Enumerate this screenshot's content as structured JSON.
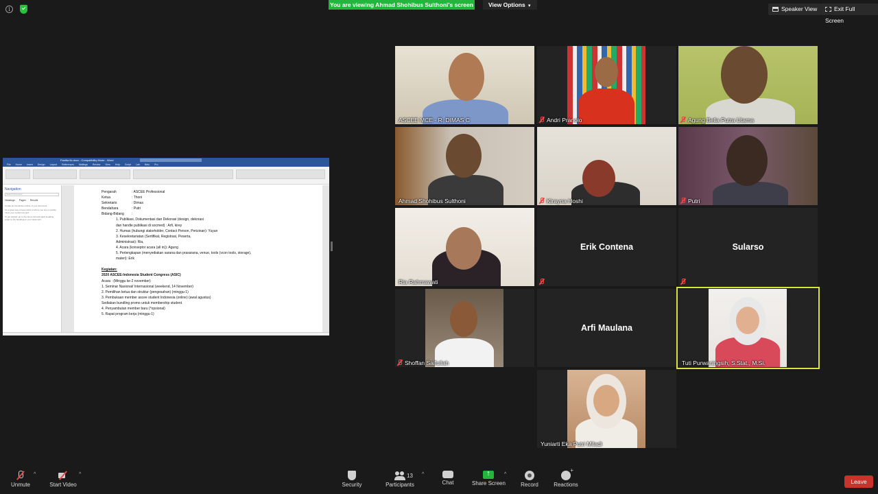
{
  "topbar": {
    "viewing_banner": "You are viewing Ahmad Shohibus Sulthoni's screen",
    "view_options": "View Options",
    "speaker_view": "Speaker View",
    "exit_full_screen": "Exit Full Screen"
  },
  "document": {
    "window_title": "Panitia fix.docx - Compatibility Mode - Word",
    "ribbon_tabs": [
      "File",
      "Home",
      "Insert",
      "Design",
      "Layout",
      "References",
      "Mailings",
      "Review",
      "View",
      "Help",
      "Script Lab",
      "Nitro Pro"
    ],
    "nav_pane": {
      "title": "Navigation",
      "search_placeholder": "Search document",
      "tabs": [
        "Headings",
        "Pages",
        "Results"
      ],
      "note1": "Create an interactive outline of your document.",
      "note2": "It's a great way to keep track of where you are or quickly move your content around.",
      "note3": "To get started, go to the Home tab and apply Heading styles to the headings in your document."
    },
    "lines": [
      {
        "key": "Pengarah",
        "val": ": ASCEE Professional"
      },
      {
        "key": "Ketua",
        "val": ": Thoni"
      },
      {
        "key": "Sekretaris",
        "val": ": Dimas"
      },
      {
        "key": "Bendahara",
        "val": ": Putri"
      },
      {
        "key": "Bidang-Bidang",
        "val": ":"
      }
    ],
    "list_items": [
      "1.    Publikasi, Dokumentasi dan Dekorasi (design, dekorasi",
      "       dan handle publikasi di socmed) : Arfi, kirey",
      "2.    Humas (hubungi stakeholder, Contact Person, Perizinan): Yuyun",
      "3.    Kesekretariatan (Sertifikat, Registrasi, Peserta,",
      "       Administrasi): Ria,",
      "4.    Acara (konseptor acara (all in)): Agung",
      "5.    Perlengkapan (menyediakan sarana dan prasarana, venue, tools (vcon  tools, storage),",
      "       materi): Erik"
    ],
    "kegiatan_heading": "Kegiatan:",
    "event_title": "2020 ASCEE-Indonesia Student Congress (ASIC)",
    "event_lines": [
      "Acara : (Minggu ke-2 november)",
      "1. Seminar Nasional/ Internasional (weekend, 14 November)",
      "2. Pemilihan ketua dan struktur (pengesahan) (minggu-1)",
      "3. Pembukaan member ascee student Indonesia (online) (awal agustus)",
      "Sediakan bundling promo untuk membership student",
      "4. Penyambutan member baru (*opsional)",
      "5. Rapat program kerja (minggu-1)"
    ]
  },
  "participants": [
    {
      "name": "ASCEE MCE - R. DIMAS C",
      "muted": false
    },
    {
      "name": "Andri Pranolo",
      "muted": true
    },
    {
      "name": "Agung Bella Putra Utama",
      "muted": true
    },
    {
      "name": "Ahmad Shohibus Sulthoni",
      "muted": false
    },
    {
      "name": "Kirayna Hoshi",
      "muted": true
    },
    {
      "name": "Putri",
      "muted": true
    },
    {
      "name": "Ria Rahmawati",
      "muted": false
    },
    {
      "name": "Erik Contena",
      "muted": true
    },
    {
      "name": "Sularso",
      "muted": true
    },
    {
      "name": "Shoffan Saifullah",
      "muted": true
    },
    {
      "name": "Arfi Maulana",
      "muted": false
    },
    {
      "name": "Tuti Purwaningsih, S.Stat., M.Si.",
      "muted": false
    },
    {
      "name": "Yuniarti Eka Putri Miladi",
      "muted": false
    }
  ],
  "toolbar": {
    "unmute": "Unmute",
    "start_video": "Start Video",
    "security": "Security",
    "participants": "Participants",
    "participants_count": "13",
    "chat": "Chat",
    "share_screen": "Share Screen",
    "record": "Record",
    "reactions": "Reactions",
    "leave": "Leave"
  },
  "colors": {
    "banner_green": "#22b73c",
    "active_speaker_border": "#d9e63d",
    "leave_red": "#c8342c",
    "word_blue": "#2b579a"
  }
}
